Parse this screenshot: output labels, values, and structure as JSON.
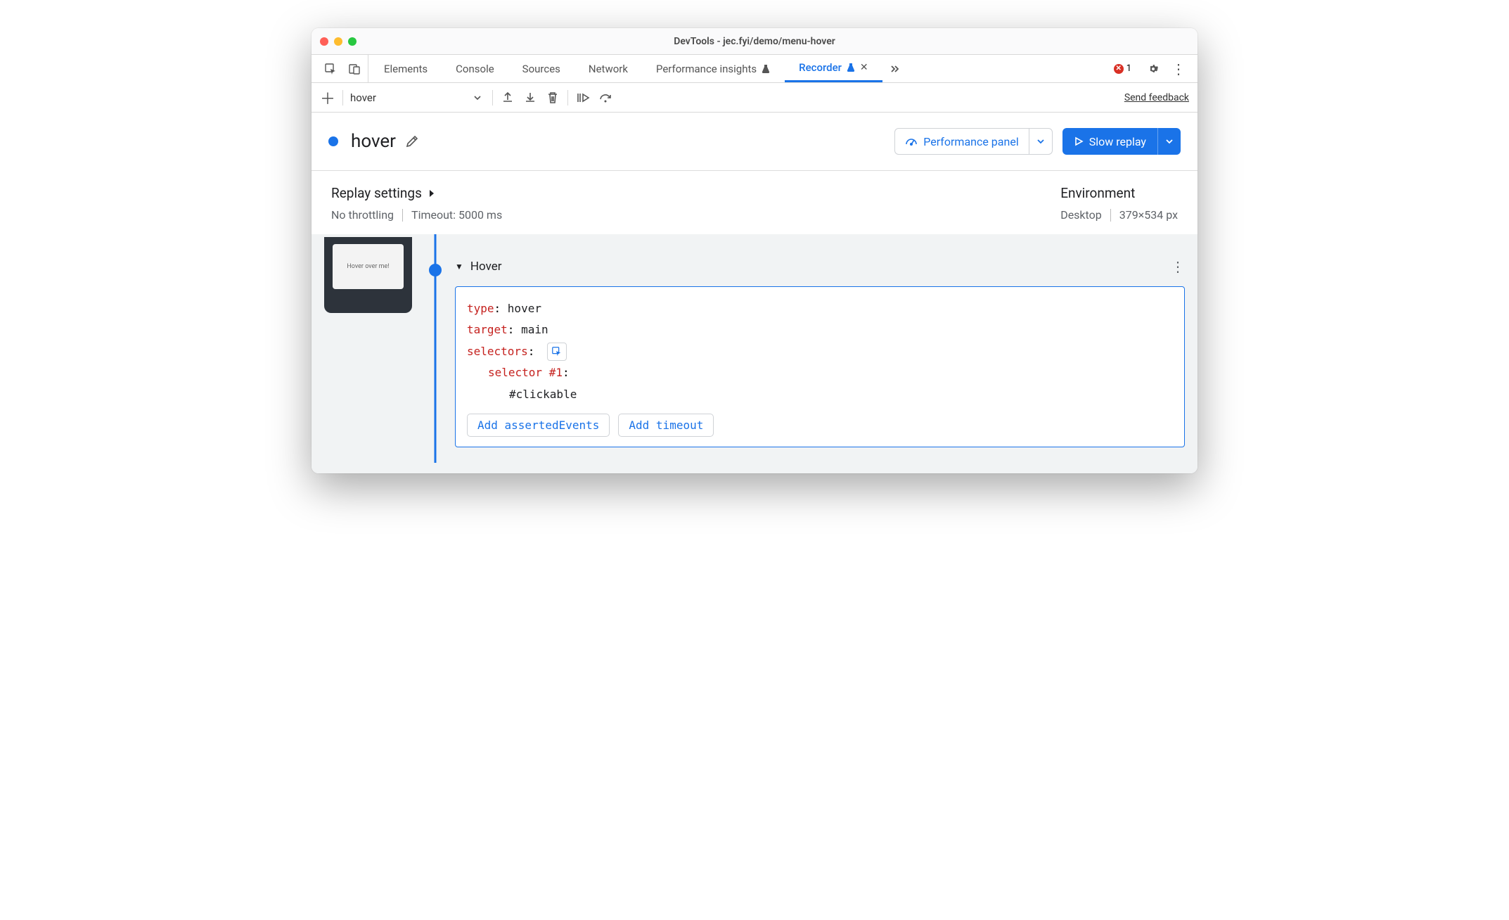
{
  "window": {
    "title": "DevTools - jec.fyi/demo/menu-hover"
  },
  "tabs": {
    "items": [
      "Elements",
      "Console",
      "Sources",
      "Network",
      "Performance insights",
      "Recorder"
    ],
    "active": "Recorder",
    "errors_count": "1"
  },
  "toolbar": {
    "recording_name": "hover",
    "feedback": "Send feedback"
  },
  "header": {
    "title": "hover",
    "perf_button": "Performance panel",
    "replay_button": "Slow replay"
  },
  "settings": {
    "replay_heading": "Replay settings",
    "throttling": "No throttling",
    "timeout": "Timeout: 5000 ms",
    "env_heading": "Environment",
    "device": "Desktop",
    "dimensions": "379×534 px"
  },
  "thumbnail": {
    "label": "Hover over me!"
  },
  "step": {
    "title": "Hover",
    "type_key": "type",
    "type_val": "hover",
    "target_key": "target",
    "target_val": "main",
    "selectors_key": "selectors",
    "selector1_key": "selector #1",
    "selector1_val": "#clickable",
    "add_asserted": "Add assertedEvents",
    "add_timeout": "Add timeout"
  }
}
